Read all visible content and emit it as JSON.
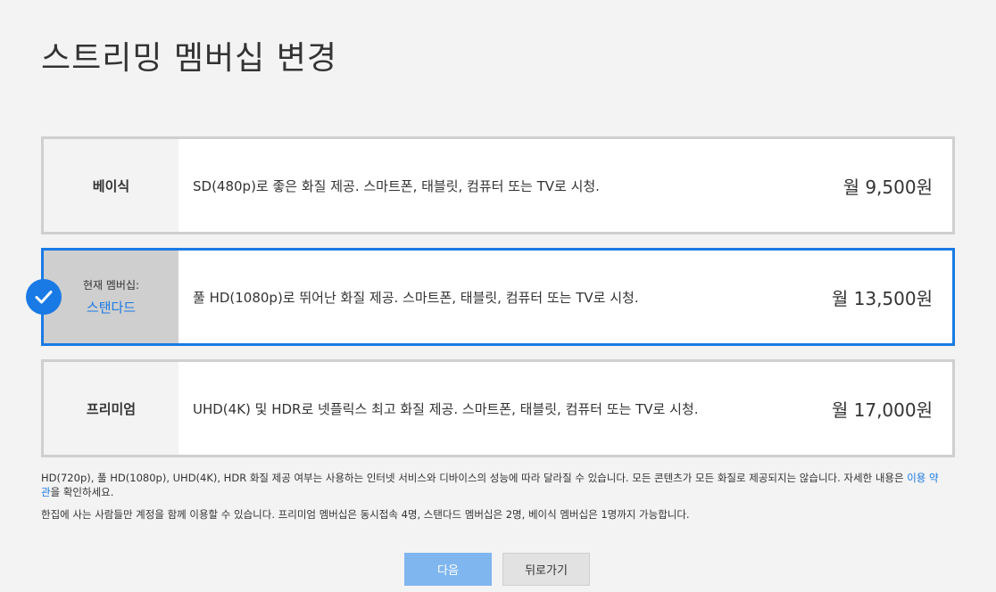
{
  "page": {
    "title": "스트리밍 멤버십 변경"
  },
  "plans": [
    {
      "name": "베이식",
      "description": "SD(480p)로 좋은 화질 제공. 스마트폰, 태블릿, 컴퓨터 또는 TV로 시청.",
      "price": "월 9,500원",
      "selected": false
    },
    {
      "current_label": "현재 멤버십:",
      "name": "스탠다드",
      "description": "풀 HD(1080p)로 뛰어난 화질 제공. 스마트폰, 태블릿, 컴퓨터 또는 TV로 시청.",
      "price": "월 13,500원",
      "selected": true
    },
    {
      "name": "프리미엄",
      "description": "UHD(4K) 및 HDR로 넷플릭스 최고 화질 제공. 스마트폰, 태블릿, 컴퓨터 또는 TV로 시청.",
      "price": "월 17,000원",
      "selected": false
    }
  ],
  "notes": {
    "quality_text_1": "HD(720p), 풀 HD(1080p), UHD(4K), HDR 화질 제공 여부는 사용하는 인터넷 서비스와 디바이스의 성능에 따라 달라질 수 있습니다. 모든 콘텐츠가 모든 화질로 제공되지는 않습니다. 자세한 내용은 ",
    "terms_link": "이용 약관",
    "quality_text_2": "을 확인하세요.",
    "household": "한집에 사는 사람들만 계정을 함께 이용할 수 있습니다. 프리미엄 멤버십은 동시접속 4명, 스탠다드 멤버십은 2명, 베이식 멤버십은 1명까지 가능합니다."
  },
  "buttons": {
    "next": "다음",
    "back": "뒤로가기"
  },
  "colors": {
    "accent": "#1a7ae5",
    "next_button": "#7fb6f0",
    "background": "#f3f3f3"
  },
  "icons": {
    "selected_check": "check-icon"
  }
}
